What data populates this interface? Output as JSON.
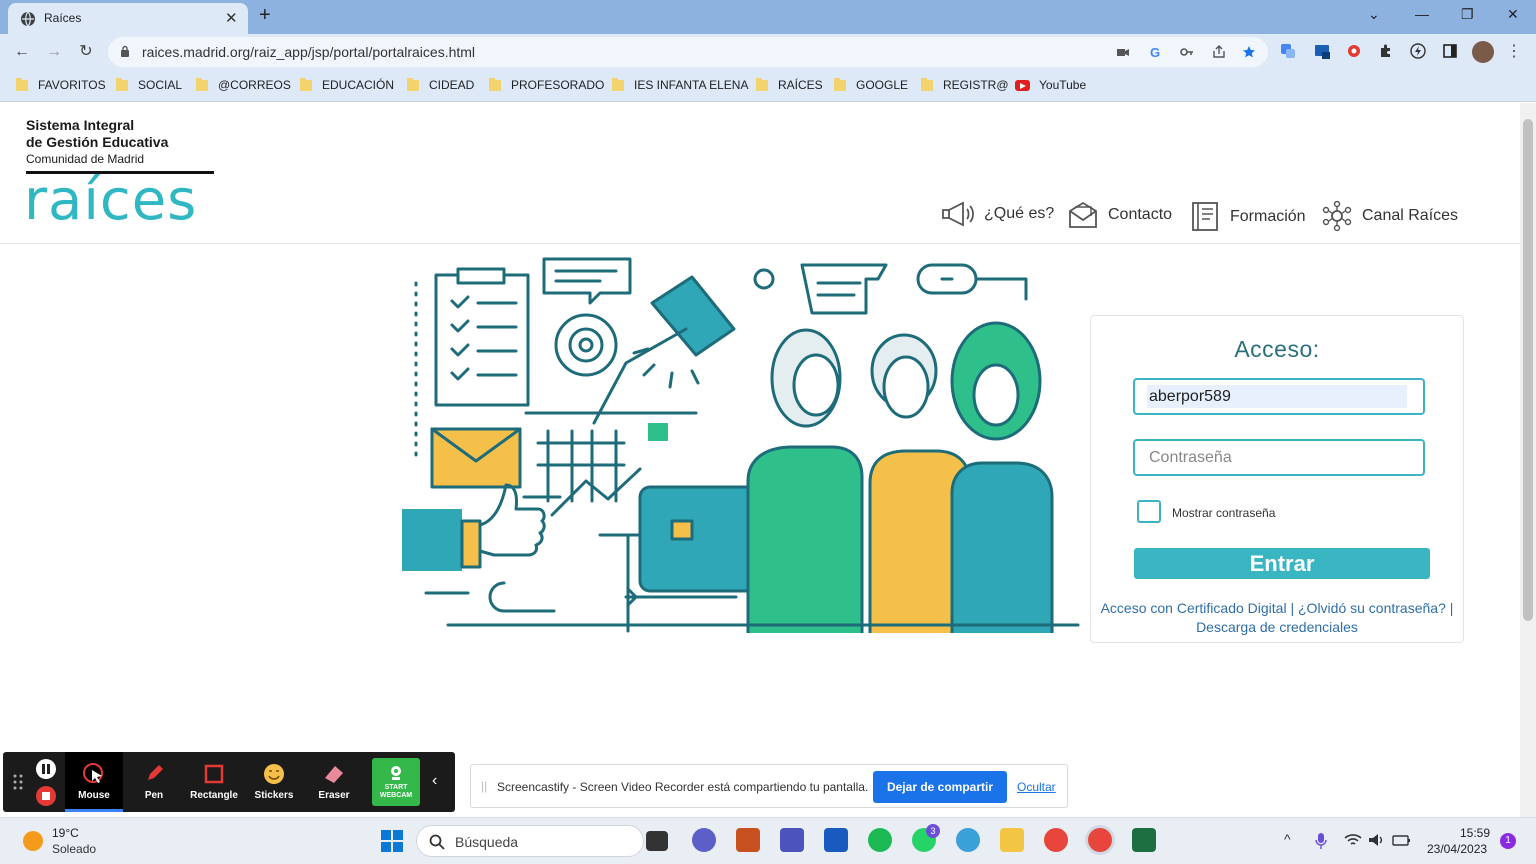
{
  "browser": {
    "tab_title": "Raíces",
    "url": "raices.madrid.org/raiz_app/jsp/portal/portalraices.html",
    "bookmarks": [
      "FAVORITOS",
      "SOCIAL",
      "@CORREOS",
      "EDUCACIÓN",
      "CIDEAD",
      "PROFESORADO",
      "IES INFANTA ELENA",
      "RAÍCES",
      "GOOGLE",
      "REGISTR@",
      "YouTube"
    ]
  },
  "header": {
    "logo_line1": "Sistema Integral",
    "logo_line2": "de Gestión Educativa",
    "logo_line3": "Comunidad de Madrid",
    "logo_word": "raíces",
    "nav": [
      "¿Qué es?",
      "Contacto",
      "Formación",
      "Canal Raíces"
    ]
  },
  "login": {
    "heading": "Acceso:",
    "username_value": "aberpor589",
    "password_placeholder": "Contraseña",
    "show_password_label": "Mostrar contraseña",
    "submit_label": "Entrar",
    "link_cert": "Acceso con Certificado Digital",
    "link_forgot": "¿Olvidó su contraseña?",
    "link_credentials": "Descarga de credenciales",
    "separator": "|"
  },
  "screencastify": {
    "tools": [
      "Mouse",
      "Pen",
      "Rectangle",
      "Stickers",
      "Eraser"
    ],
    "webcam_line1": "START",
    "webcam_line2": "WEBCAM",
    "share_text": "Screencastify - Screen Video Recorder está compartiendo tu pantalla.",
    "stop_label": "Dejar de compartir",
    "hide_label": "Ocultar"
  },
  "taskbar": {
    "temp": "19°C",
    "condition": "Soleado",
    "search_placeholder": "Búsqueda",
    "teams_badge": "3",
    "time": "15:59",
    "date": "23/04/2023",
    "notifications": "1"
  },
  "colors": {
    "accent": "#3ab6c2",
    "link": "#2f6ea8",
    "chrome_frame": "#8db2e0"
  }
}
